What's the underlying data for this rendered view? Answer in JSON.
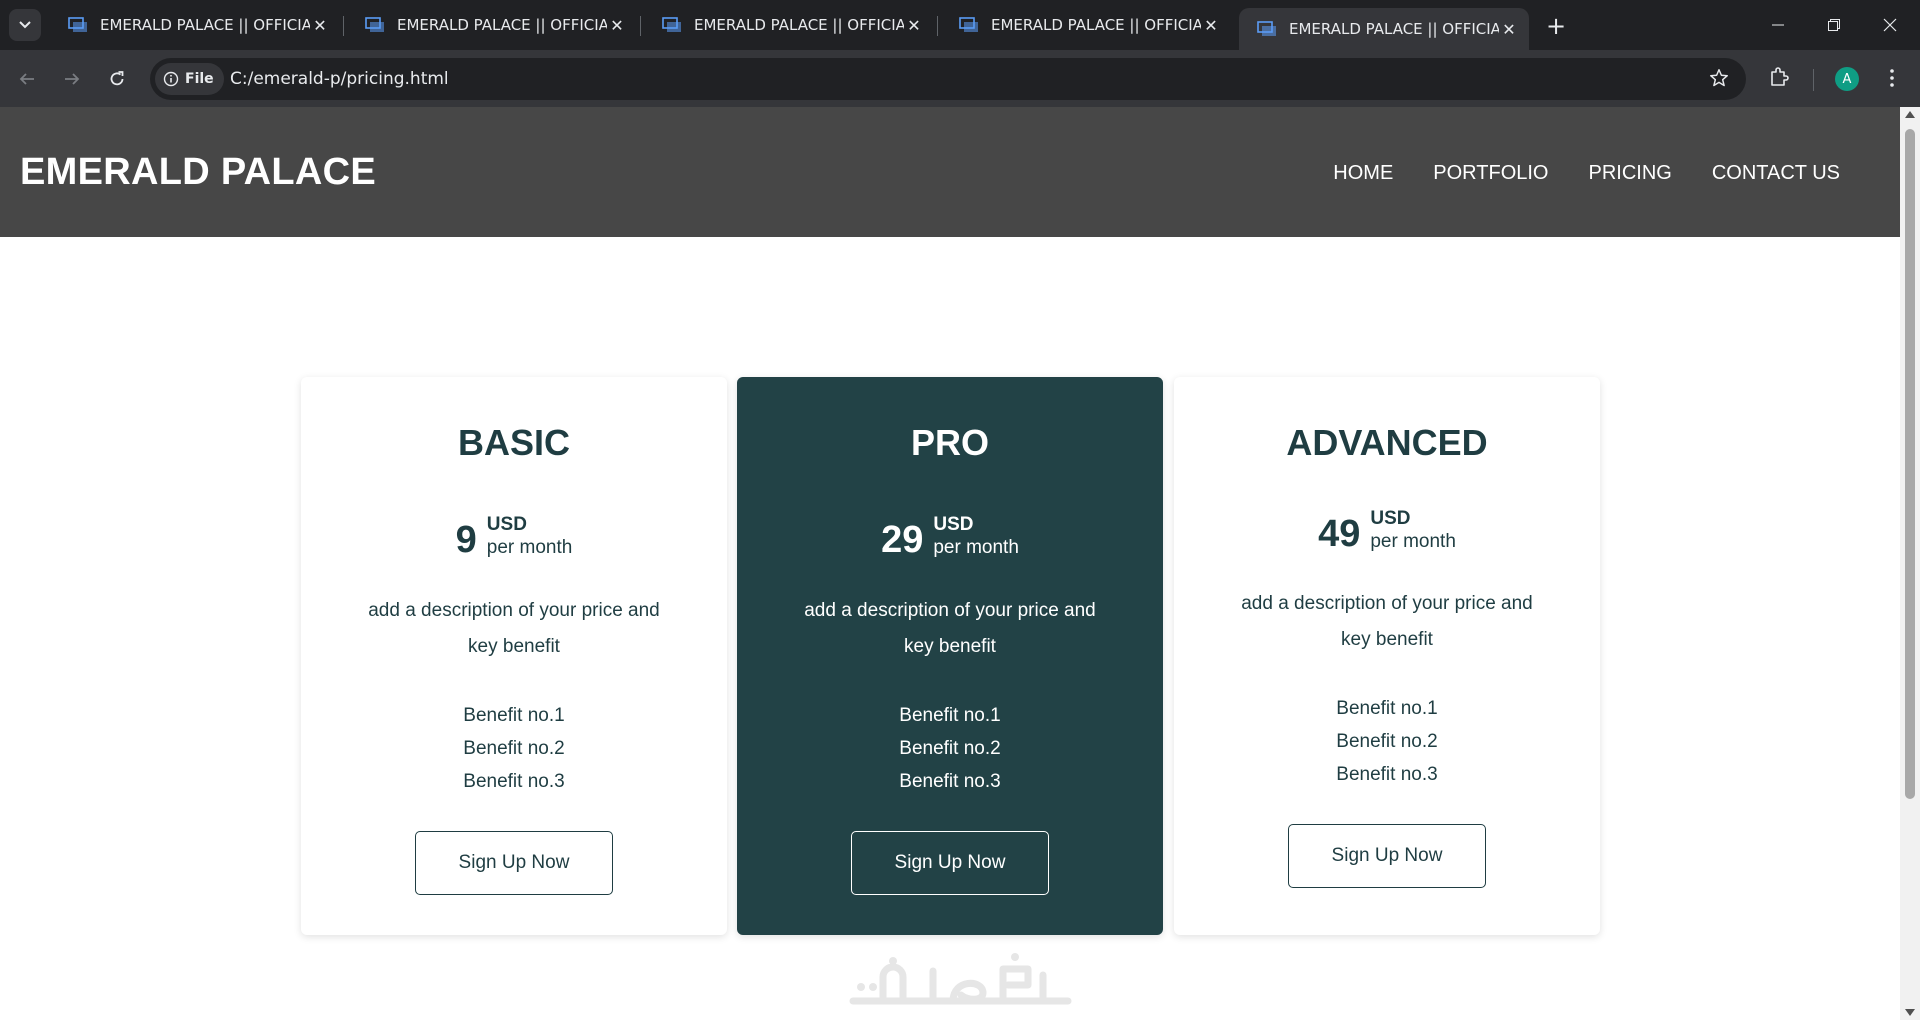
{
  "browser": {
    "tabs": [
      {
        "title": "EMERALD PALACE || OFFICIAL",
        "active": false
      },
      {
        "title": "EMERALD PALACE || OFFICIAL",
        "active": false
      },
      {
        "title": "EMERALD PALACE || OFFICIAL",
        "active": false
      },
      {
        "title": "EMERALD PALACE || OFFICIAL",
        "active": false
      },
      {
        "title": "EMERALD PALACE || OFFICIAL",
        "active": true
      }
    ],
    "address": {
      "scheme_label": "File",
      "url": "C:/emerald-p/pricing.html"
    },
    "profile_initial": "A",
    "profile_color": "#0f9d84",
    "icons": [
      "tab-search-icon",
      "close-icon",
      "plus-icon",
      "minimize-icon",
      "restore-icon",
      "window-close-icon",
      "back-arrow-icon",
      "forward-arrow-icon",
      "reload-icon",
      "info-icon",
      "star-icon",
      "extensions-icon",
      "kebab-menu-icon"
    ]
  },
  "site": {
    "brand": "EMERALD PALACE",
    "nav": [
      "HOME",
      "PORTFOLIO",
      "PRICING",
      "CONTACT US"
    ],
    "header_bg": "#474747"
  },
  "plans": [
    {
      "name": "BASIC",
      "price": "9",
      "currency": "USD",
      "period": "per month",
      "description": "add a description of your price and key benefit",
      "benefits": [
        "Benefit no.1",
        "Benefit no.2",
        "Benefit no.3"
      ],
      "cta": "Sign Up Now",
      "featured": false
    },
    {
      "name": "PRO",
      "price": "29",
      "currency": "USD",
      "period": "per month",
      "description": "add a description of your price and key benefit",
      "benefits": [
        "Benefit no.1",
        "Benefit no.2",
        "Benefit no.3"
      ],
      "cta": "Sign Up Now",
      "featured": true
    },
    {
      "name": "ADVANCED",
      "price": "49",
      "currency": "USD",
      "period": "per month",
      "description": "add a description of your price and key benefit",
      "benefits": [
        "Benefit no.1",
        "Benefit no.2",
        "Benefit no.3"
      ],
      "cta": "Sign Up Now",
      "featured": false
    }
  ],
  "colors": {
    "accent_dark_teal": "#224246",
    "text_teal": "#1f3d42"
  },
  "watermark": "خمسات"
}
